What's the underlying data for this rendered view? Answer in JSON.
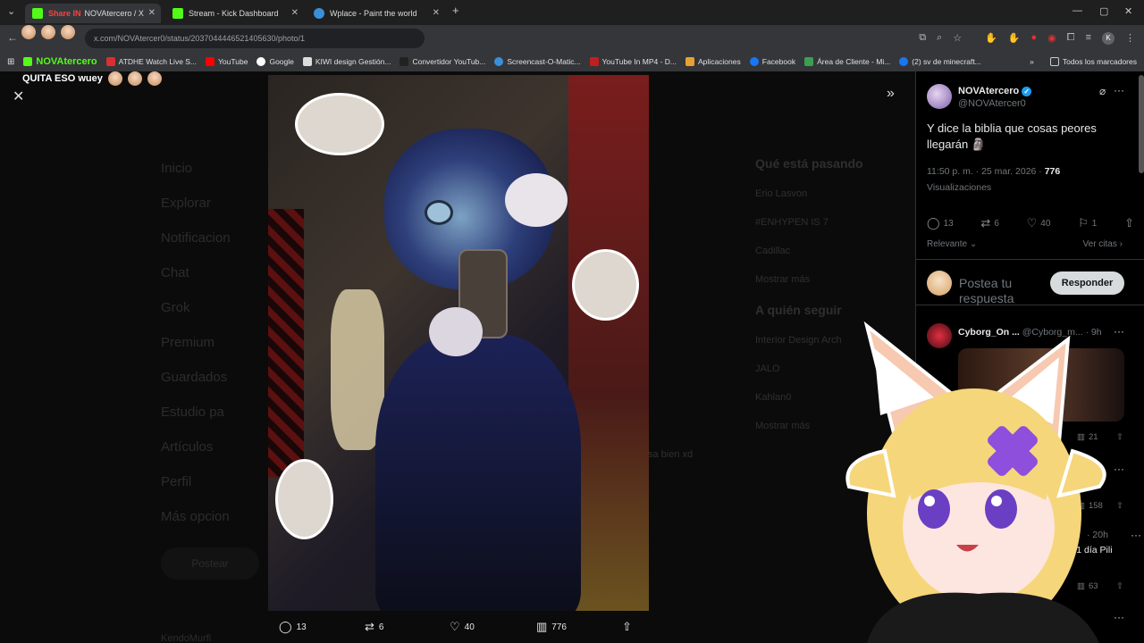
{
  "browser": {
    "tabs": [
      {
        "title": "NOVAtercero / X",
        "overlay": "Share IN"
      },
      {
        "title": "Stream - Kick Dashboard"
      },
      {
        "title": "Wplace - Paint the world"
      }
    ],
    "url": "x.com/NOVAtercer0/status/2037044446521405630/photo/1",
    "bookmarks": [
      "NOVAtercero",
      "ATDHE Watch Live S...",
      "YouTube",
      "Google",
      "KIWI design Gestión...",
      "Convertidor YouTub...",
      "Screencast-O-Matic...",
      "YouTube In MP4 - D...",
      "Aplicaciones",
      "Facebook",
      "Área de Cliente - Mi...",
      "(2) sv de minecraft...",
      "Todos los marcadores"
    ],
    "profile_letter": "K"
  },
  "overlay": {
    "chat_message": "QUITA ESO wuey"
  },
  "photo_viewer": {
    "actions": {
      "replies": "13",
      "reposts": "6",
      "likes": "40",
      "views": "776"
    }
  },
  "background_nav": {
    "items": [
      "Inicio",
      "Explorar",
      "Notificacion",
      "Chat",
      "Grok",
      "Premium",
      "Guardados",
      "Estudio pa",
      "Artículos",
      "Perfil",
      "Más opcion"
    ],
    "post_button": "Postear",
    "bottom_user": "KendoMurfi",
    "right_heading": "Qué está pasando",
    "right_items": [
      "Erio Lasvon",
      "#ENHYPEN IS 7",
      "Cadillac",
      "Mostrar más"
    ],
    "follow_heading": "A quién seguir",
    "follow_items": [
      "Interior Design Arch",
      "JALO",
      "Kahlan0"
    ],
    "follow_more": "Mostrar más",
    "right_footer": "sa bien xd"
  },
  "tweet": {
    "display_name": "NOVAtercero",
    "handle": "@NOVAtercer0",
    "text": "Y dice la biblia que cosas peores llegarán",
    "time": "11:50 p. m. · 25 mar. 2026 ·",
    "views_count": "776",
    "views_label": "Visualizaciones",
    "replies": "13",
    "reposts": "6",
    "likes": "40",
    "bookmarks": "1",
    "sort_label": "Relevante",
    "quotes_link": "Ver citas"
  },
  "reply_composer": {
    "placeholder": "Postea tu respuesta",
    "button": "Responder"
  },
  "replies": [
    {
      "name": "Cyborg_On ...",
      "handle": "@Cyborg_m...",
      "time": "· 9h",
      "views": "21"
    },
    {
      "views": "158"
    },
    {
      "time": "· 20h",
      "text_fragment": "or 1 día Pili",
      "views": "63"
    }
  ]
}
